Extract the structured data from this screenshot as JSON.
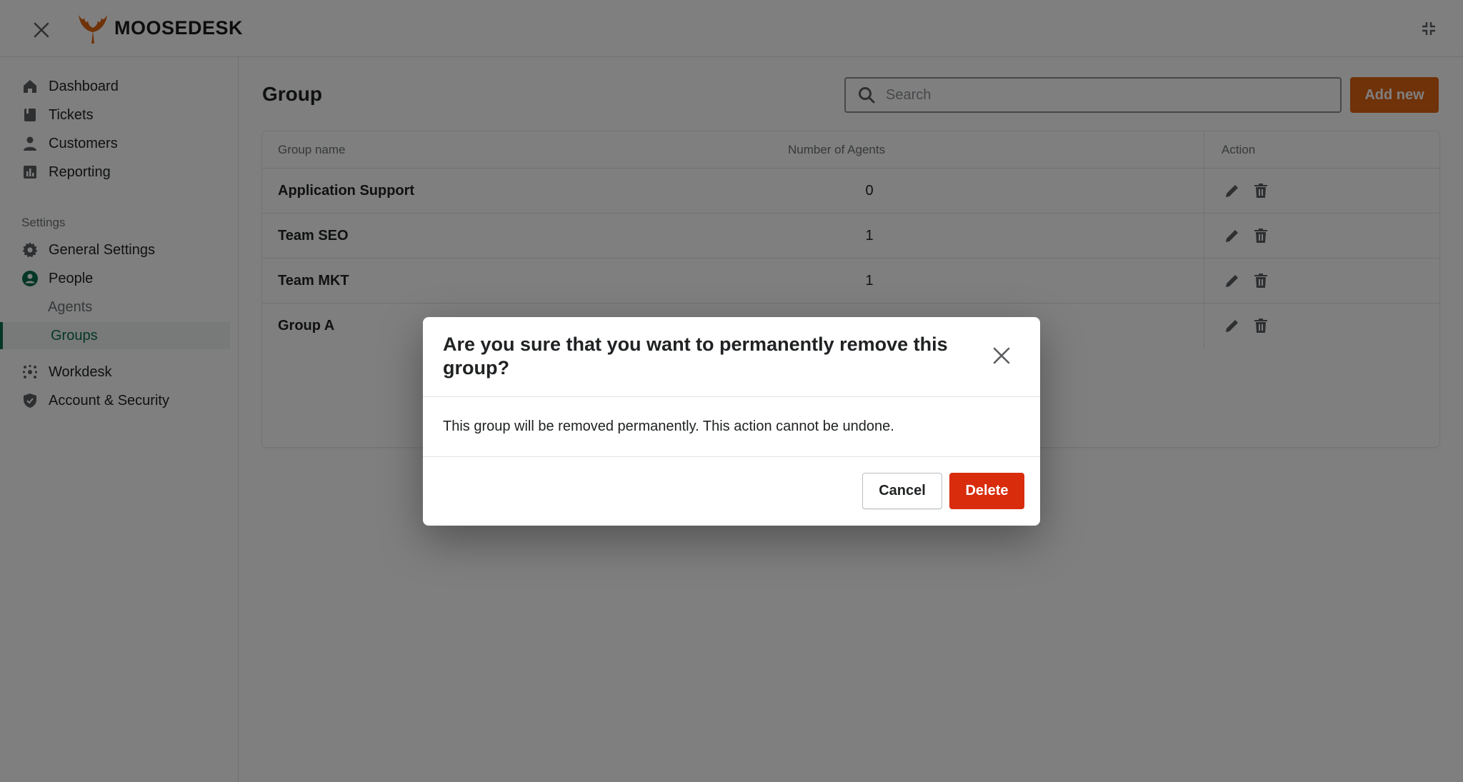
{
  "app": {
    "brand": "MOOSEDESK",
    "brand_color": "#e06412"
  },
  "sidebar": {
    "main_items": [
      {
        "label": "Dashboard",
        "icon": "home-icon"
      },
      {
        "label": "Tickets",
        "icon": "ticket-icon"
      },
      {
        "label": "Customers",
        "icon": "person-icon"
      },
      {
        "label": "Reporting",
        "icon": "chart-icon"
      }
    ],
    "settings_label": "Settings",
    "settings_items": [
      {
        "label": "General Settings",
        "icon": "gear-icon"
      },
      {
        "label": "People",
        "icon": "people-icon"
      }
    ],
    "people_subitems": [
      {
        "label": "Agents",
        "active": false
      },
      {
        "label": "Groups",
        "active": true
      }
    ],
    "bottom_items": [
      {
        "label": "Workdesk",
        "icon": "workdesk-icon"
      },
      {
        "label": "Account & Security",
        "icon": "shield-icon"
      }
    ],
    "active_color": "#0b6e4f"
  },
  "page": {
    "title": "Group",
    "search_placeholder": "Search",
    "add_label": "Add new"
  },
  "table": {
    "headers": {
      "name": "Group name",
      "agents": "Number of Agents",
      "action": "Action"
    },
    "rows": [
      {
        "name": "Application Support",
        "agents": "0"
      },
      {
        "name": "Team SEO",
        "agents": "1"
      },
      {
        "name": "Team MKT",
        "agents": "1"
      },
      {
        "name": "Group A",
        "agents": ""
      }
    ]
  },
  "modal": {
    "title": "Are you sure that you want to permanently remove this group?",
    "body": "This group will be removed permanently. This action cannot be undone.",
    "cancel_label": "Cancel",
    "delete_label": "Delete",
    "delete_color": "#d82c0d"
  }
}
